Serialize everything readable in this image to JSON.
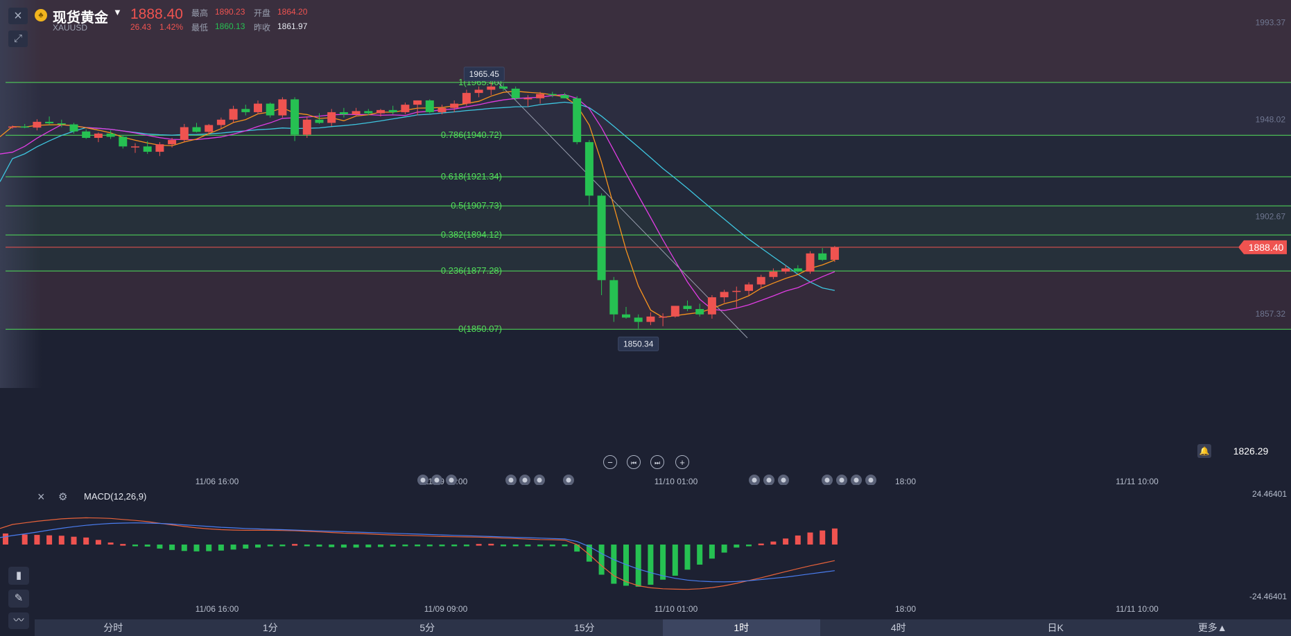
{
  "header": {
    "close_icon": "×",
    "expand_icon": "⤢",
    "coin_icon": "♣",
    "name": "现货黄金",
    "caret": "▼",
    "symbol": "XAUUSD",
    "price": "1888.40",
    "change": "26.43",
    "change_pct": "1.42%",
    "stats": {
      "high_label": "最高",
      "high": "1890.23",
      "open_label": "开盘",
      "open": "1864.20",
      "low_label": "最低",
      "low": "1860.13",
      "prev_label": "昨收",
      "prev": "1861.97"
    }
  },
  "controls": {
    "minus": "−",
    "prev": "⏮",
    "next": "⏭",
    "plus": "+"
  },
  "price_axis_current": "1826.29",
  "macd_panel": {
    "close_icon": "×",
    "gear_icon": "⚙",
    "label": "MACD(12,26,9)"
  },
  "side_tools": [
    {
      "name": "bar-chart-icon",
      "glyph": "▮"
    },
    {
      "name": "pen-icon",
      "glyph": "✎"
    },
    {
      "name": "line-chart-icon",
      "glyph": "〰"
    }
  ],
  "tabs": [
    "分时",
    "1分",
    "5分",
    "15分",
    "1时",
    "4时",
    "日K",
    "更多▲"
  ],
  "active_tab": "1时",
  "colors": {
    "up": "#ef5350",
    "down": "#26c152",
    "fib": "#52e05a",
    "ma5": "#f7931e",
    "ma10": "#e03de3",
    "ma20": "#3ec6e0"
  },
  "chart_data": [
    {
      "type": "candlestick",
      "title": "现货黄金 XAUUSD",
      "y_ticks": [
        "1993.37",
        "1948.02",
        "1902.67",
        "1857.32"
      ],
      "ylim": [
        1826.29,
        2000.0
      ],
      "x_ticks": [
        "11/06 16:00",
        "11/09 09:00",
        "11/10 01:00",
        "18:00",
        "11/11 10:00"
      ],
      "current_price_label": "1888.40",
      "high_marker": "1965.45",
      "low_marker": "1850.34",
      "fibonacci": [
        {
          "label": "1(1965.40)",
          "value": 1965.4
        },
        {
          "label": "0.786(1940.72)",
          "value": 1940.72
        },
        {
          "label": "0.618(1921.34)",
          "value": 1921.34
        },
        {
          "label": "0.5(1907.73)",
          "value": 1907.73
        },
        {
          "label": "0.382(1894.12)",
          "value": 1894.12
        },
        {
          "label": "0.236(1877.28)",
          "value": 1877.28
        },
        {
          "label": "0(1850.07)",
          "value": 1850.07
        }
      ],
      "candles": [
        [
          1944.5,
          1945.3,
          1943.8,
          1944.8
        ],
        [
          1944.8,
          1946.0,
          1944.0,
          1944.3
        ],
        [
          1944.3,
          1948.2,
          1943.0,
          1947.0
        ],
        [
          1947.0,
          1949.5,
          1945.5,
          1946.3
        ],
        [
          1946.3,
          1948.0,
          1944.5,
          1945.8
        ],
        [
          1945.8,
          1946.5,
          1941.5,
          1942.5
        ],
        [
          1942.5,
          1943.5,
          1939.0,
          1939.5
        ],
        [
          1939.5,
          1942.0,
          1937.5,
          1941.5
        ],
        [
          1941.5,
          1943.0,
          1939.0,
          1940.0
        ],
        [
          1940.0,
          1940.8,
          1934.5,
          1935.5
        ],
        [
          1935.5,
          1937.0,
          1932.5,
          1935.5
        ],
        [
          1935.5,
          1938.0,
          1932.0,
          1933.0
        ],
        [
          1933.0,
          1937.5,
          1931.0,
          1936.5
        ],
        [
          1936.5,
          1939.5,
          1935.0,
          1938.5
        ],
        [
          1938.5,
          1946.0,
          1937.5,
          1944.5
        ],
        [
          1944.5,
          1946.5,
          1942.0,
          1942.3
        ],
        [
          1942.3,
          1946.0,
          1941.0,
          1945.5
        ],
        [
          1945.5,
          1949.0,
          1944.0,
          1948.0
        ],
        [
          1948.0,
          1954.5,
          1946.5,
          1953.0
        ],
        [
          1953.0,
          1955.0,
          1950.0,
          1951.5
        ],
        [
          1951.5,
          1957.0,
          1950.5,
          1955.5
        ],
        [
          1955.5,
          1956.0,
          1949.0,
          1950.0
        ],
        [
          1950.0,
          1958.5,
          1949.0,
          1957.5
        ],
        [
          1957.5,
          1958.5,
          1938.0,
          1941.0
        ],
        [
          1941.0,
          1949.5,
          1939.5,
          1948.0
        ],
        [
          1948.0,
          1951.0,
          1946.0,
          1946.5
        ],
        [
          1946.5,
          1953.0,
          1945.0,
          1951.5
        ],
        [
          1951.5,
          1953.5,
          1949.0,
          1950.5
        ],
        [
          1950.5,
          1953.5,
          1949.5,
          1952.0
        ],
        [
          1952.0,
          1953.0,
          1950.0,
          1951.0
        ],
        [
          1951.0,
          1953.0,
          1949.5,
          1952.5
        ],
        [
          1952.5,
          1954.5,
          1950.5,
          1951.5
        ],
        [
          1951.5,
          1956.0,
          1950.5,
          1955.0
        ],
        [
          1955.0,
          1957.0,
          1950.0,
          1957.0
        ],
        [
          1957.0,
          1957.5,
          1951.0,
          1951.5
        ],
        [
          1951.5,
          1955.0,
          1950.5,
          1953.5
        ],
        [
          1953.5,
          1957.0,
          1951.5,
          1955.5
        ],
        [
          1955.5,
          1962.0,
          1954.5,
          1960.5
        ],
        [
          1960.5,
          1963.5,
          1958.5,
          1962.0
        ],
        [
          1962.0,
          1965.4,
          1959.5,
          1963.5
        ],
        [
          1963.5,
          1965.0,
          1961.5,
          1962.5
        ],
        [
          1962.5,
          1963.5,
          1957.0,
          1958.0
        ],
        [
          1958.0,
          1959.5,
          1954.0,
          1958.0
        ],
        [
          1958.0,
          1961.0,
          1955.5,
          1960.0
        ],
        [
          1960.0,
          1961.0,
          1958.5,
          1959.5
        ],
        [
          1959.5,
          1960.5,
          1958.0,
          1958.0
        ],
        [
          1958.0,
          1959.0,
          1936.5,
          1937.5
        ],
        [
          1937.5,
          1938.5,
          1908.0,
          1912.5
        ],
        [
          1912.5,
          1913.5,
          1866.0,
          1873.0
        ],
        [
          1873.0,
          1874.5,
          1853.5,
          1857.0
        ],
        [
          1857.0,
          1860.5,
          1855.0,
          1855.5
        ],
        [
          1855.5,
          1857.0,
          1850.34,
          1853.5
        ],
        [
          1853.5,
          1858.0,
          1852.0,
          1856.0
        ],
        [
          1856.0,
          1857.5,
          1851.5,
          1856.0
        ],
        [
          1856.0,
          1861.0,
          1855.5,
          1861.0
        ],
        [
          1861.0,
          1863.5,
          1858.5,
          1859.5
        ],
        [
          1859.5,
          1862.0,
          1856.0,
          1857.0
        ],
        [
          1857.0,
          1866.0,
          1855.0,
          1865.0
        ],
        [
          1865.0,
          1868.5,
          1862.5,
          1867.5
        ],
        [
          1867.5,
          1870.0,
          1860.0,
          1868.0
        ],
        [
          1868.0,
          1872.0,
          1866.0,
          1871.0
        ],
        [
          1871.0,
          1875.5,
          1869.0,
          1874.5
        ],
        [
          1874.5,
          1878.5,
          1873.5,
          1877.0
        ],
        [
          1877.0,
          1880.0,
          1876.0,
          1878.5
        ],
        [
          1878.5,
          1880.0,
          1876.5,
          1877.0
        ],
        [
          1877.0,
          1886.5,
          1876.0,
          1885.5
        ],
        [
          1885.5,
          1888.0,
          1882.0,
          1882.5
        ],
        [
          1882.5,
          1889.0,
          1881.5,
          1888.4
        ]
      ]
    },
    {
      "type": "bar",
      "title": "MACD(12,26,9)",
      "y_ticks": [
        "24.46401",
        "-24.46401"
      ],
      "ylim": [
        -24.46401,
        24.46401
      ],
      "x_ticks": [
        "11/06 16:00",
        "11/09 09:00",
        "11/10 01:00",
        "18:00",
        "11/11 10:00"
      ],
      "histogram": [
        5.5,
        5.0,
        4.8,
        4.6,
        4.4,
        3.9,
        3.5,
        2.3,
        1.0,
        0.3,
        -0.3,
        -1.0,
        -2.0,
        -2.7,
        -3.2,
        -3.4,
        -3.3,
        -3.0,
        -2.5,
        -2.0,
        -1.5,
        -0.9,
        -0.3,
        0.3,
        -0.4,
        -1.0,
        -1.3,
        -1.5,
        -1.5,
        -1.4,
        -1.2,
        -1.0,
        -0.8,
        -0.7,
        -0.6,
        -0.5,
        -0.4,
        -0.3,
        0.3,
        0.4,
        -0.3,
        -0.4,
        -0.6,
        -0.7,
        -0.6,
        -0.3,
        -3.5,
        -8.5,
        -15.0,
        -19.5,
        -20.5,
        -21.0,
        -20.0,
        -17.5,
        -15.5,
        -12.5,
        -10.0,
        -7.0,
        -4.0,
        -1.5,
        -0.5,
        0.5,
        1.5,
        3.0,
        4.5,
        6.0,
        7.0,
        8.0
      ],
      "dif": [
        10.0,
        10.8,
        11.6,
        12.2,
        12.8,
        13.1,
        13.3,
        13.2,
        13.0,
        12.5,
        12.0,
        11.4,
        10.6,
        9.8,
        9.0,
        8.3,
        7.8,
        7.4,
        7.2,
        7.1,
        7.1,
        7.1,
        7.0,
        6.9,
        6.6,
        6.3,
        6.0,
        5.7,
        5.5,
        5.3,
        5.0,
        4.8,
        4.6,
        4.4,
        4.2,
        4.0,
        3.9,
        3.8,
        3.7,
        3.5,
        3.2,
        3.0,
        2.7,
        2.5,
        2.4,
        2.2,
        0.0,
        -5.0,
        -10.5,
        -15.5,
        -18.5,
        -20.5,
        -21.5,
        -22.0,
        -22.2,
        -22.3,
        -22.0,
        -21.4,
        -20.5,
        -19.3,
        -17.9,
        -16.5,
        -15.0,
        -13.5,
        -12.0,
        -10.6,
        -9.3,
        -8.0
      ],
      "dea": [
        4.5,
        5.3,
        6.2,
        7.2,
        8.1,
        8.9,
        9.6,
        10.1,
        10.5,
        10.7,
        10.8,
        10.7,
        10.5,
        10.2,
        9.8,
        9.4,
        9.0,
        8.6,
        8.3,
        8.0,
        7.8,
        7.6,
        7.4,
        7.2,
        7.0,
        6.8,
        6.6,
        6.4,
        6.2,
        6.0,
        5.8,
        5.6,
        5.4,
        5.2,
        5.0,
        4.8,
        4.6,
        4.4,
        4.2,
        4.0,
        3.8,
        3.6,
        3.4,
        3.2,
        3.0,
        2.8,
        1.5,
        -1.0,
        -4.5,
        -7.5,
        -10.0,
        -12.2,
        -14.0,
        -15.6,
        -16.8,
        -17.7,
        -18.2,
        -18.5,
        -18.6,
        -18.4,
        -18.0,
        -17.4,
        -16.8,
        -16.2,
        -15.4,
        -14.6,
        -13.8,
        -13.0
      ]
    }
  ]
}
